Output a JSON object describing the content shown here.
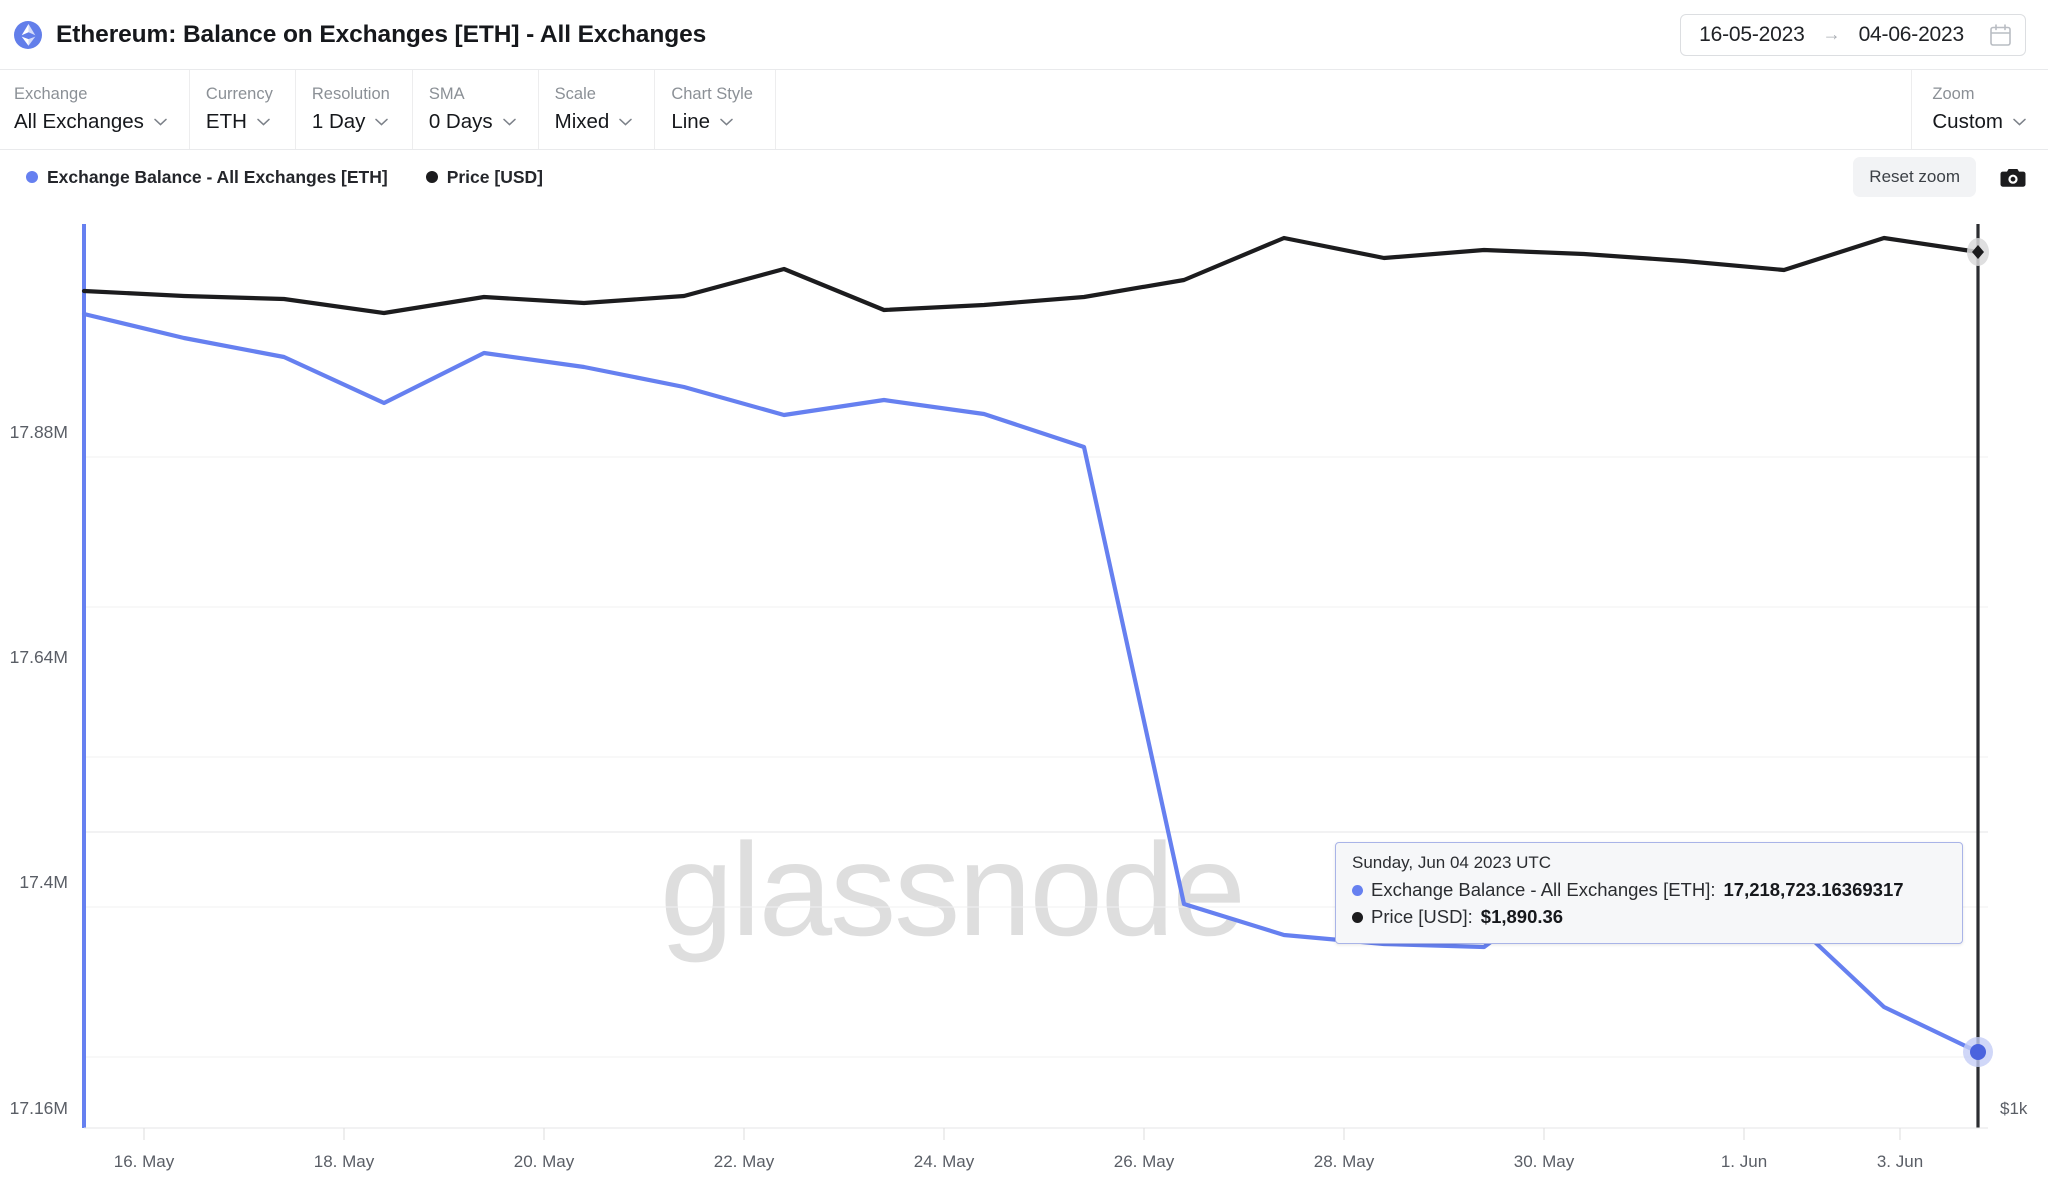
{
  "header": {
    "title": "Ethereum: Balance on Exchanges [ETH] - All Exchanges",
    "asset_icon": "ethereum-icon",
    "accent_color": "#627eea",
    "daterange": {
      "start": "16-05-2023",
      "arrow": "→",
      "end": "04-06-2023",
      "calendar_icon": "calendar-icon"
    }
  },
  "controls": [
    {
      "key": "exchange",
      "label": "Exchange",
      "value": "All Exchanges"
    },
    {
      "key": "currency",
      "label": "Currency",
      "value": "ETH"
    },
    {
      "key": "resolution",
      "label": "Resolution",
      "value": "1 Day"
    },
    {
      "key": "sma",
      "label": "SMA",
      "value": "0 Days"
    },
    {
      "key": "scale",
      "label": "Scale",
      "value": "Mixed"
    },
    {
      "key": "chart_style",
      "label": "Chart Style",
      "value": "Line"
    }
  ],
  "zoom_control": {
    "label": "Zoom",
    "value": "Custom"
  },
  "legend": {
    "items": [
      {
        "label": "Exchange Balance - All Exchanges [ETH]",
        "color": "#6680f0"
      },
      {
        "label": "Price [USD]",
        "color": "#1c1c1e"
      }
    ],
    "reset_zoom_label": "Reset zoom",
    "camera_icon": "camera-icon"
  },
  "watermark": "glassnode",
  "tooltip": {
    "date": "Sunday, Jun 04 2023 UTC",
    "rows": [
      {
        "color": "#6680f0",
        "label": "Exchange Balance - All Exchanges [ETH]:",
        "value": "17,218,723.16369317"
      },
      {
        "color": "#1c1c1e",
        "label": "Price [USD]:",
        "value": "$1,890.36"
      }
    ]
  },
  "chart_data": {
    "type": "line",
    "title": "Ethereum: Balance on Exchanges [ETH] - All Exchanges",
    "xlabel": "",
    "ylabel": "",
    "grid": true,
    "legend_position": "top-left",
    "x": [
      "2023-05-16",
      "2023-05-17",
      "2023-05-18",
      "2023-05-19",
      "2023-05-20",
      "2023-05-21",
      "2023-05-22",
      "2023-05-23",
      "2023-05-24",
      "2023-05-25",
      "2023-05-26",
      "2023-05-27",
      "2023-05-28",
      "2023-05-29",
      "2023-05-30",
      "2023-05-31",
      "2023-06-01",
      "2023-06-02",
      "2023-06-03",
      "2023-06-04"
    ],
    "x_tick_labels": [
      "16. May",
      "18. May",
      "20. May",
      "22. May",
      "24. May",
      "26. May",
      "28. May",
      "30. May",
      "1. Jun",
      "3. Jun"
    ],
    "y_tick_labels": [
      "17.88M",
      "17.64M",
      "17.4M",
      "17.16M"
    ],
    "y_tick_values": [
      17880000,
      17640000,
      17400000,
      17160000
    ],
    "ylim": [
      17100000,
      18040000
    ],
    "y2_tick_labels": [
      "$1k"
    ],
    "series": [
      {
        "name": "Exchange Balance - All Exchanges [ETH]",
        "color": "#6680f0",
        "axis": "left",
        "unit": "ETH",
        "values": [
          17975000,
          17940000,
          17920000,
          17882000,
          17930000,
          17921000,
          17905000,
          17878000,
          17888000,
          17876000,
          17852000,
          17440000,
          17380000,
          17363000,
          17358000,
          17404000,
          17371000,
          17380000,
          17290000,
          17218723
        ]
      },
      {
        "name": "Price [USD]",
        "color": "#1c1c1e",
        "axis": "right",
        "unit": "USD",
        "values": [
          1820,
          1815,
          1812,
          1800,
          1812,
          1808,
          1812,
          1833,
          1806,
          1808,
          1812,
          1822,
          1884,
          1866,
          1872,
          1868,
          1862,
          1855,
          1884,
          1890
        ]
      }
    ],
    "end_markers": [
      {
        "series": "Exchange Balance - All Exchanges [ETH]",
        "shape": "circle",
        "color": "#4a63de"
      },
      {
        "series": "Price [USD]",
        "shape": "diamond",
        "color": "#1c1c1e"
      }
    ],
    "crosshair_date": "2023-06-04"
  }
}
